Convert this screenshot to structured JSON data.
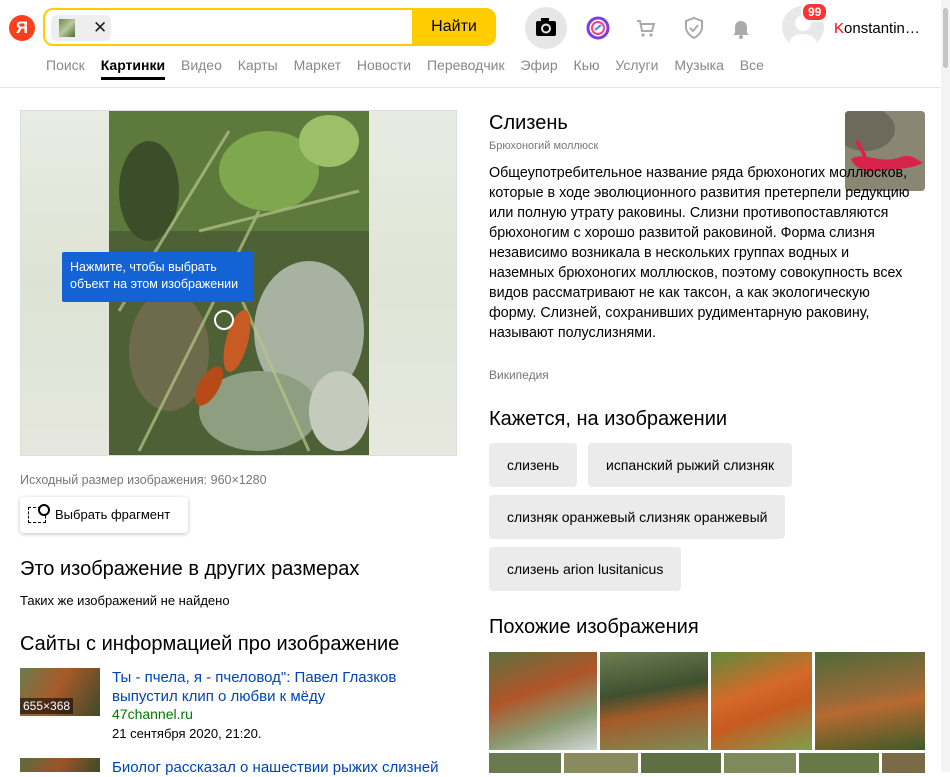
{
  "header": {
    "logo": "Я",
    "search_value": "",
    "find_label": "Найти",
    "notifications_count": "99",
    "username_first": "K",
    "username_rest": "onstantin…"
  },
  "tabs": [
    {
      "label": "Поиск",
      "active": false
    },
    {
      "label": "Картинки",
      "active": true
    },
    {
      "label": "Видео",
      "active": false
    },
    {
      "label": "Карты",
      "active": false
    },
    {
      "label": "Маркет",
      "active": false
    },
    {
      "label": "Новости",
      "active": false
    },
    {
      "label": "Переводчик",
      "active": false
    },
    {
      "label": "Эфир",
      "active": false
    },
    {
      "label": "Кью",
      "active": false
    },
    {
      "label": "Услуги",
      "active": false
    },
    {
      "label": "Музыка",
      "active": false
    },
    {
      "label": "Все",
      "active": false
    }
  ],
  "image_panel": {
    "tooltip_line1": "Нажмите, чтобы выбрать",
    "tooltip_line2": "объект на этом изображении",
    "original_size": "Исходный размер изображения: 960×1280",
    "select_fragment": "Выбрать фрагмент"
  },
  "other_sizes": {
    "heading": "Это изображение в других размерах",
    "empty_text": "Таких же изображений не найдено"
  },
  "sites": {
    "heading": "Сайты с информацией про изображение",
    "items": [
      {
        "thumb_size": "655×368",
        "title_line1": "Ты - пчела, я - пчеловод\": Павел Глазков",
        "title_line2": "выпустил клип о любви к мёду",
        "domain": "47channel.ru",
        "date": "21 сентября 2020, 21:20."
      },
      {
        "title_line1": "Биолог рассказал о нашествии рыжих слизней"
      }
    ]
  },
  "entity": {
    "title": "Слизень",
    "subtitle": "Брюхоногий моллюск",
    "description": "Общеупотребительное название ряда брюхоногих моллюсков, которые в ходе эволюционного развития претерпели редукцию или полную утрату раковины. Слизни противопоставляются брюхоногим с хорошо развитой раковиной. Форма слизня независимо возникала в нескольких группах водных и наземных брюхоногих моллюсков, поэтому совокупность всех видов рассматривают не как таксон, а как экологическую форму. Слизней, сохранивших рудиментарную раковину, называют полуслизнями.",
    "source": "Википедия"
  },
  "tags": {
    "heading": "Кажется, на изображении",
    "items": [
      "слизень",
      "испанский рыжий слизняк",
      "слизняк оранжевый слизняк оранжевый",
      "слизень arion lusitanicus"
    ]
  },
  "similar": {
    "heading": "Похожие изображения"
  },
  "colors": {
    "accent_yellow": "#ffcc00",
    "brand_red": "#fc3f1d",
    "link_blue": "#0044bb",
    "tooltip_blue": "#1463d4"
  }
}
